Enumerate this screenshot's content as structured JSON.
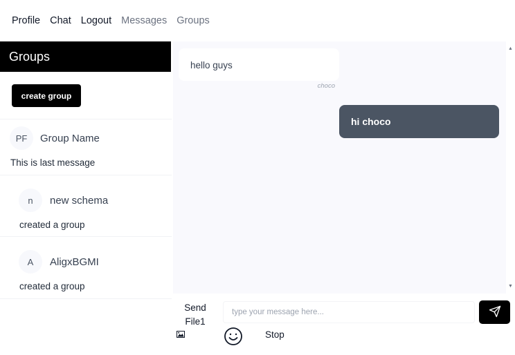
{
  "nav": {
    "items": [
      {
        "label": "Profile"
      },
      {
        "label": "Chat"
      },
      {
        "label": "Logout"
      },
      {
        "label": "Messages"
      },
      {
        "label": "Groups"
      }
    ]
  },
  "sidebar": {
    "title": "Groups",
    "create_button": "create group",
    "groups": [
      {
        "initials": "PF",
        "name": "Group Name",
        "last_message": "This is last message"
      },
      {
        "initials": "n",
        "name": "new schema",
        "last_message": "created a group"
      },
      {
        "initials": "A",
        "name": "AligxBGMI",
        "last_message": "created a group"
      }
    ]
  },
  "chat": {
    "messages": [
      {
        "text": "hello guys",
        "sender": "choco",
        "direction": "incoming"
      },
      {
        "text": "hi choco",
        "direction": "outgoing"
      }
    ]
  },
  "composer": {
    "send_file_label": "Send File1",
    "input_placeholder": "type your message here...",
    "input_value": "",
    "stop_label": "Stop",
    "icons": {
      "image": "image-icon",
      "send": "paper-plane-icon",
      "emoji": "smiley-icon"
    }
  },
  "colors": {
    "sidebar_header": "#000000",
    "outgoing_bubble": "#4b5563",
    "chat_background": "#f9f9fd"
  }
}
